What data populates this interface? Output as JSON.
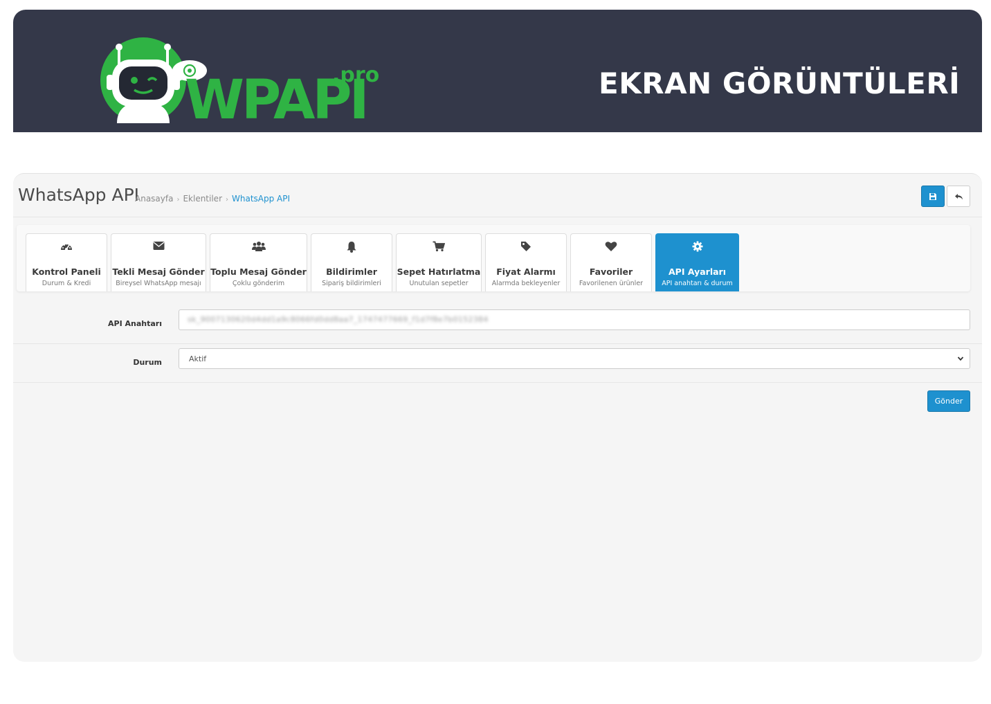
{
  "banner": {
    "logo": {
      "brand": "WPAPI",
      "suffix": ".pro"
    },
    "title": "EKRAN GÖRÜNTÜLERİ",
    "icons": {
      "robot": "robot-mascot-icon",
      "chat": "whatsapp-bubble-icon"
    },
    "colors": {
      "background": "#343849",
      "green": "#2fb344",
      "white": "#ffffff"
    }
  },
  "header": {
    "title": "WhatsApp API",
    "breadcrumb": [
      {
        "label": "Anasayfa"
      },
      {
        "label": "Eklentiler"
      },
      {
        "label": "WhatsApp API"
      }
    ],
    "breadcrumb_separator": "›",
    "buttons": {
      "save": {
        "icon": "save-icon"
      },
      "back": {
        "icon": "reply-icon"
      }
    }
  },
  "tabs": [
    {
      "label": "Kontrol Paneli",
      "sub": "Durum & Kredi",
      "icon": "dashboard-icon"
    },
    {
      "label": "Tekli Mesaj Gönder",
      "sub": "Bireysel WhatsApp mesajı",
      "icon": "envelope-icon"
    },
    {
      "label": "Toplu Mesaj Gönder",
      "sub": "Çoklu gönderim",
      "icon": "users-icon"
    },
    {
      "label": "Bildirimler",
      "sub": "Sipariş bildirimleri",
      "icon": "bell-icon"
    },
    {
      "label": "Sepet Hatırlatma",
      "sub": "Unutulan sepetler",
      "icon": "cart-icon"
    },
    {
      "label": "Fiyat Alarmı",
      "sub": "Alarmda bekleyenler",
      "icon": "tag-icon"
    },
    {
      "label": "Favoriler",
      "sub": "Favorilenen ürünler",
      "icon": "heart-icon"
    },
    {
      "label": "API Ayarları",
      "sub": "API anahtarı & durum",
      "icon": "gear-icon",
      "active": true
    }
  ],
  "form": {
    "api_key": {
      "label": "API Anahtarı",
      "value": "sk_9007130620d4dd1a9c8066fd0dd8aa7_1747477669_f1d7f8e7b0152384"
    },
    "status": {
      "label": "Durum",
      "value": "Aktif"
    },
    "submit_label": "Gönder"
  },
  "colors": {
    "accent": "#1e91cf",
    "page_bg": "#f5f5f5"
  }
}
